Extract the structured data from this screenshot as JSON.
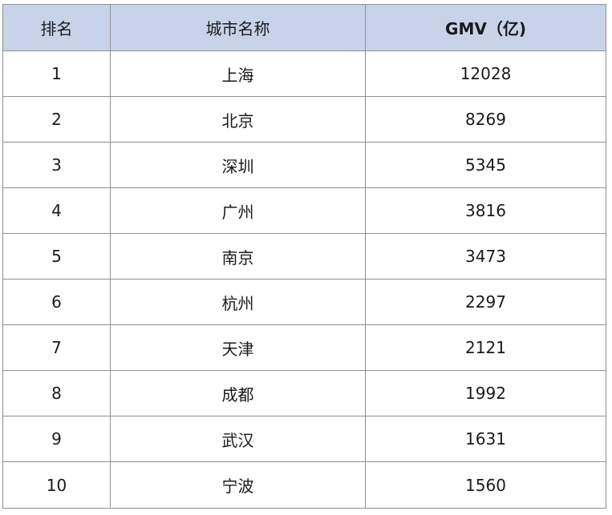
{
  "table": {
    "headers": {
      "rank": "排名",
      "city": "城市名称",
      "gmv": "GMV（亿)"
    },
    "rows": [
      {
        "rank": "1",
        "city": "上海",
        "gmv": "12028"
      },
      {
        "rank": "2",
        "city": "北京",
        "gmv": "8269"
      },
      {
        "rank": "3",
        "city": "深圳",
        "gmv": "5345"
      },
      {
        "rank": "4",
        "city": "广州",
        "gmv": "3816"
      },
      {
        "rank": "5",
        "city": "南京",
        "gmv": "3473"
      },
      {
        "rank": "6",
        "city": "杭州",
        "gmv": "2297"
      },
      {
        "rank": "7",
        "city": "天津",
        "gmv": "2121"
      },
      {
        "rank": "8",
        "city": "成都",
        "gmv": "1992"
      },
      {
        "rank": "9",
        "city": "武汉",
        "gmv": "1631"
      },
      {
        "rank": "10",
        "city": "宁波",
        "gmv": "1560"
      }
    ]
  },
  "colors": {
    "header_bg": "#c8d3ea",
    "border": "#8f8f8f"
  }
}
